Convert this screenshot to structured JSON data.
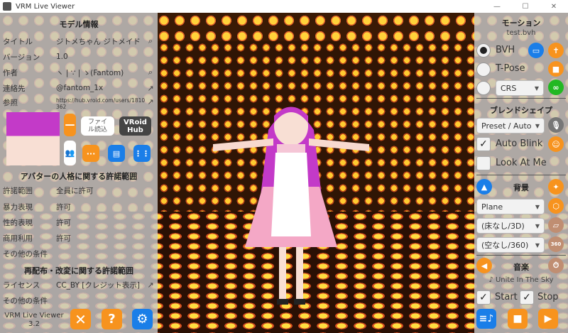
{
  "window": {
    "title": "VRM Live Viewer",
    "controls": [
      "—",
      "☐",
      "✕"
    ]
  },
  "left": {
    "model_info_header": "モデル情報",
    "info": [
      {
        "key": "タイトル",
        "value": "ジトメちゃん ジトメイド",
        "icon": "search-icon"
      },
      {
        "key": "バージョン",
        "value": "1.0",
        "icon": ""
      },
      {
        "key": "作者",
        "value": "ヽ | ∵ | ゝ(Fantom)",
        "icon": "search-icon"
      },
      {
        "key": "連絡先",
        "value": "@fantom_1x",
        "icon": "external-link-icon"
      },
      {
        "key": "参照",
        "value": "https://hub.vroid.com/users/1810362",
        "icon": "external-link-icon"
      }
    ],
    "file_load_button": "ファイル読込",
    "vroid_hub_button": "VRoid Hub",
    "persona_header": "アバターの人格に関する許諾範囲",
    "persona": [
      {
        "key": "許諾範囲",
        "value": "全員に許可"
      },
      {
        "key": "暴力表現",
        "value": "許可"
      },
      {
        "key": "性的表現",
        "value": "許可"
      },
      {
        "key": "商用利用",
        "value": "許可"
      },
      {
        "key": "その他の条件",
        "value": ""
      }
    ],
    "redistribution_header": "再配布・改変に関する許諾範囲",
    "license": {
      "key": "ライセンス",
      "value": "CC_BY [クレジット表示]"
    },
    "other_conditions": "その他の条件",
    "app_name": "VRM Live Viewer",
    "version": "3.2"
  },
  "right": {
    "motion_header": "モーション",
    "motion_file": "test.bvh",
    "bvh_label": "BVH",
    "tpose_label": "T-Pose",
    "crs_select": "CRS",
    "blendshape_header": "ブレンドシェイプ",
    "blendshape_select": "Preset / Auto",
    "auto_blink_label": "Auto Blink",
    "auto_blink_checked": true,
    "look_at_me_label": "Look At Me",
    "look_at_me_checked": false,
    "background_header": "背景",
    "bg_select": "Plane",
    "floor_select": "(床なし/3D)",
    "sky_select": "(空なし/360)",
    "music_header": "音楽",
    "music_track": "♪ Unite In The Sky",
    "start_label": "Start",
    "stop_label": "Stop",
    "icon_360": "360"
  }
}
